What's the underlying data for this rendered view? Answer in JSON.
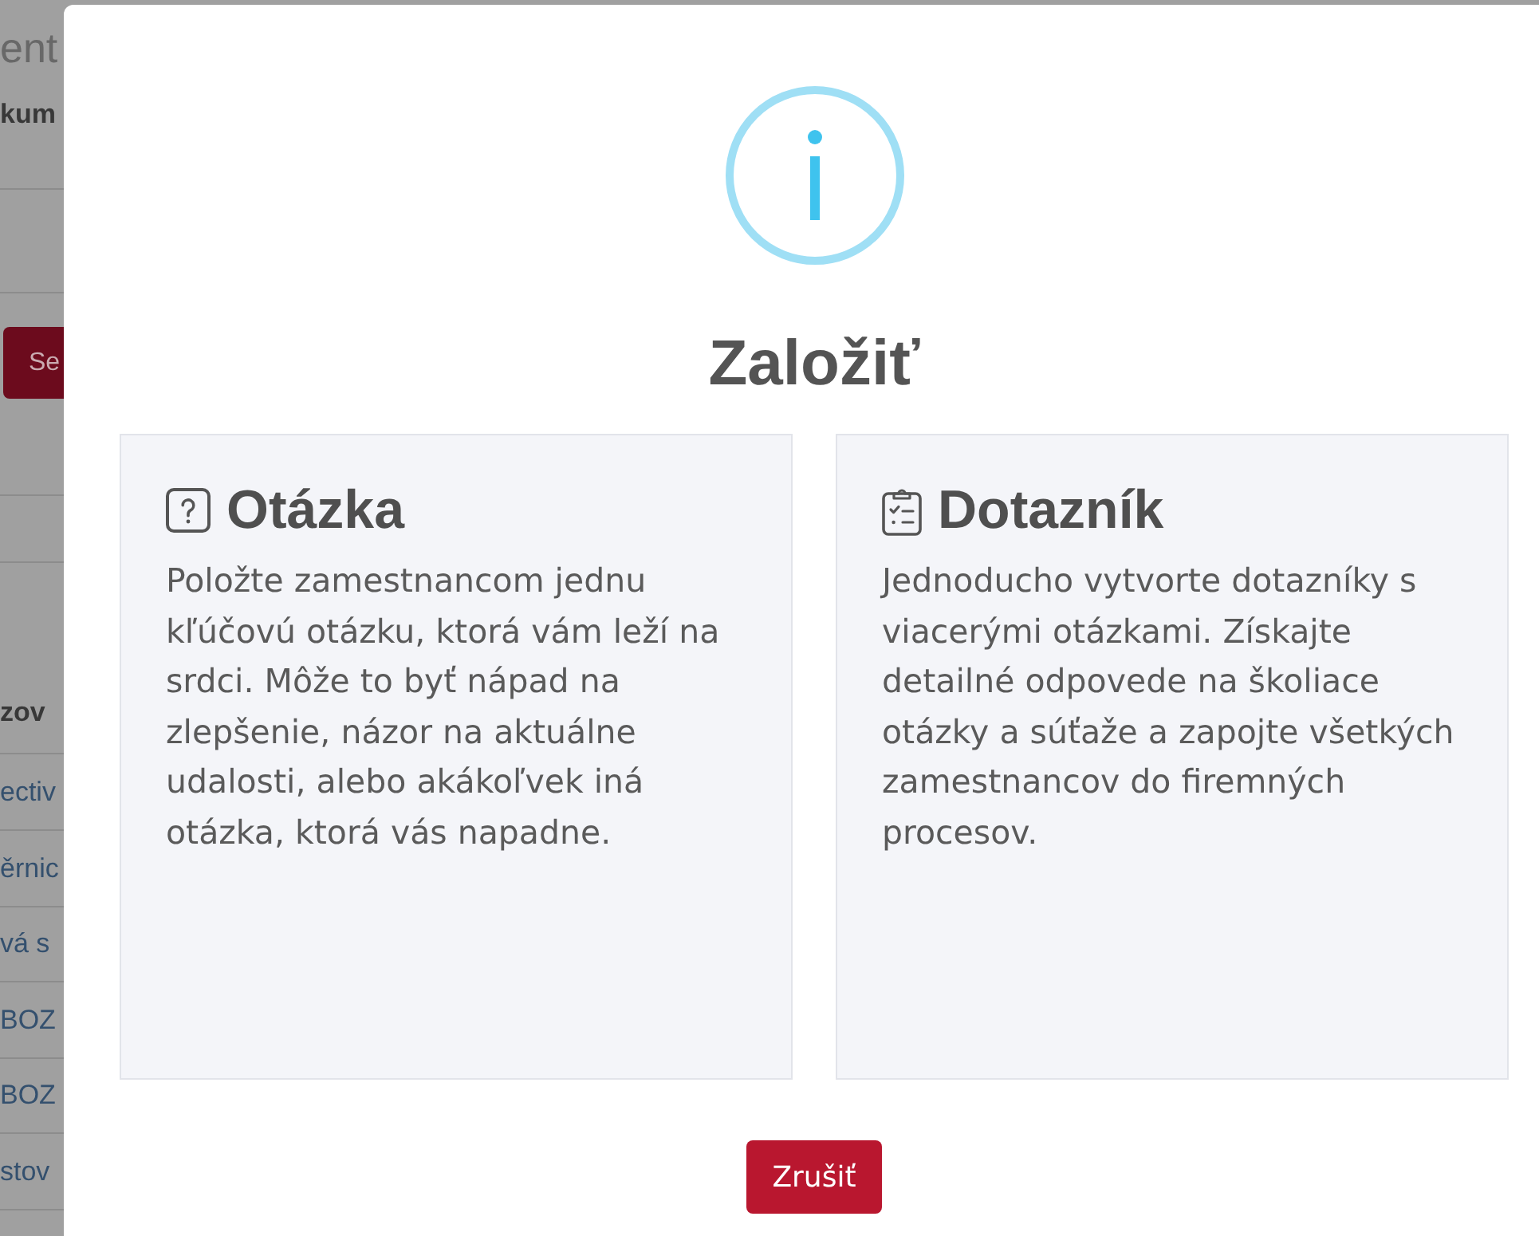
{
  "background_page": {
    "heading": "ent",
    "subheading": "kum",
    "button": "Se",
    "table": {
      "column_header": "zov",
      "rows": [
        "ectiv",
        "ěrnic",
        "vá s",
        "BOZ",
        "BOZ",
        "stov"
      ]
    }
  },
  "dialog": {
    "title": "Založiť",
    "options": [
      {
        "kind": "question",
        "title": "Otázka",
        "description": "Položte zamestnancom jednu kľúčovú otázku, ktorá vám leží na srdci. Môže to byť nápad na zlepšenie, názor na aktuálne udalosti, alebo akákoľvek iná otázka, ktorá vás napadne."
      },
      {
        "kind": "survey",
        "title": "Dotazník",
        "description": "Jednoducho vytvorte dotazníky s viacerými otázkami. Získajte detailné odpovede na školiace otázky a súťaže a zapojte všetkých zamestnancov do firemných procesov."
      }
    ],
    "cancel_button": "Zrušiť"
  }
}
